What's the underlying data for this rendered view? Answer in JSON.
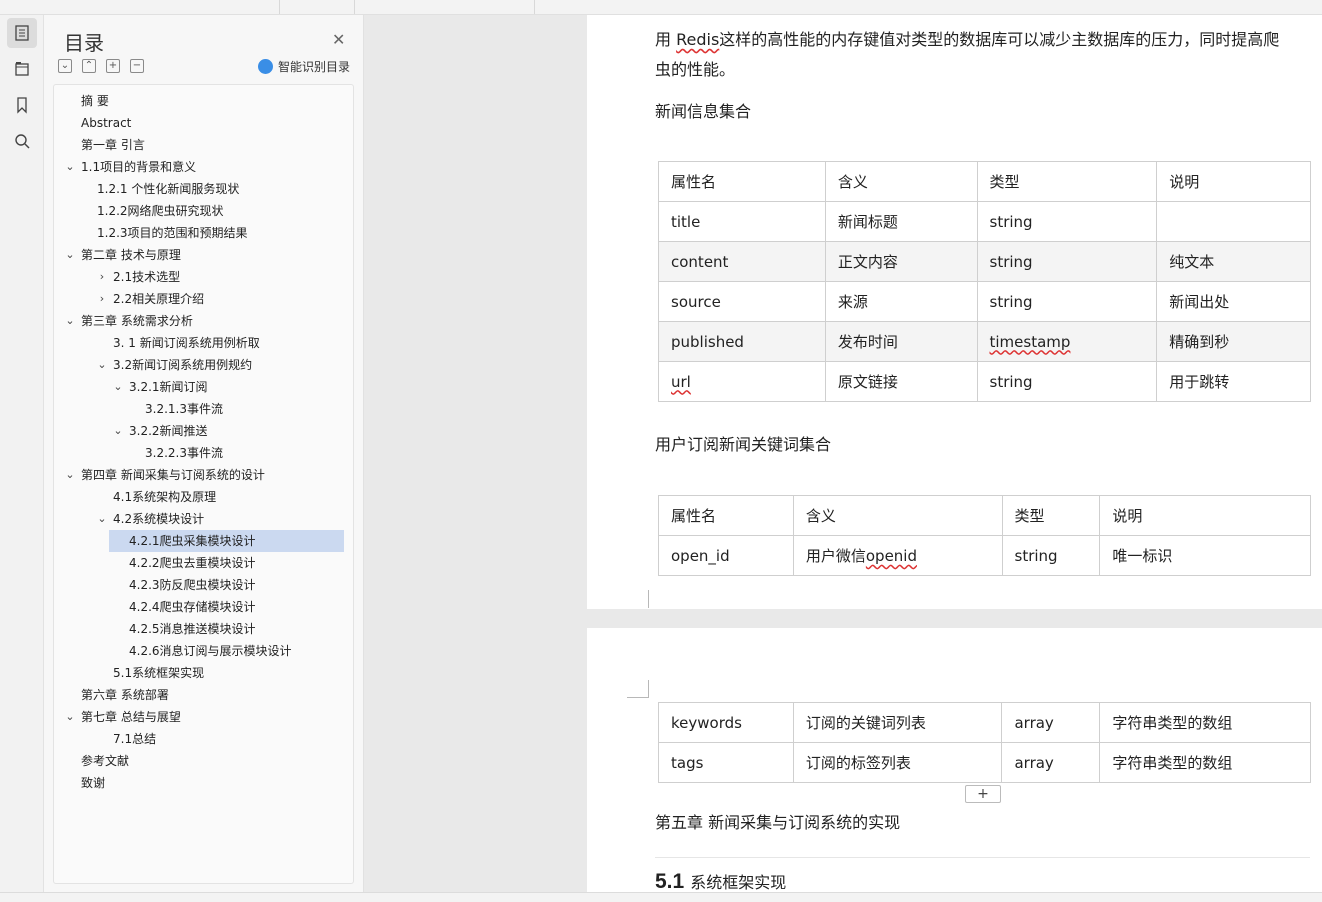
{
  "toc": {
    "title": "目录",
    "ai_label": "智能识别目录",
    "items": [
      {
        "label": "摘  要",
        "level": 0,
        "caret": ""
      },
      {
        "label": "Abstract",
        "level": 0,
        "caret": ""
      },
      {
        "label": "第一章 引言",
        "level": 0,
        "caret": ""
      },
      {
        "label": "1.1项目的背景和意义",
        "level": 0,
        "caret": "down"
      },
      {
        "label": "1.2.1 个性化新闻服务现状",
        "level": 1,
        "caret": ""
      },
      {
        "label": "1.2.2网络爬虫研究现状",
        "level": 1,
        "caret": ""
      },
      {
        "label": "1.2.3项目的范围和预期结果",
        "level": 1,
        "caret": ""
      },
      {
        "label": "第二章 技术与原理",
        "level": 0,
        "caret": "down"
      },
      {
        "label": "2.1技术选型",
        "level": 2,
        "caret": "right"
      },
      {
        "label": "2.2相关原理介绍",
        "level": 2,
        "caret": "right"
      },
      {
        "label": "第三章 系统需求分析",
        "level": 0,
        "caret": "down"
      },
      {
        "label": "3. 1 新闻订阅系统用例析取",
        "level": 2,
        "caret": ""
      },
      {
        "label": "3.2新闻订阅系统用例规约",
        "level": 2,
        "caret": "down"
      },
      {
        "label": "3.2.1新闻订阅",
        "level": 3,
        "caret": "down"
      },
      {
        "label": "3.2.1.3事件流",
        "level": 4,
        "caret": ""
      },
      {
        "label": "3.2.2新闻推送",
        "level": 3,
        "caret": "down"
      },
      {
        "label": "3.2.2.3事件流",
        "level": 4,
        "caret": ""
      },
      {
        "label": "第四章 新闻采集与订阅系统的设计",
        "level": 0,
        "caret": "down"
      },
      {
        "label": "4.1系统架构及原理",
        "level": 2,
        "caret": ""
      },
      {
        "label": "4.2系统模块设计",
        "level": 2,
        "caret": "down"
      },
      {
        "label": "4.2.1爬虫采集模块设计",
        "level": 3,
        "caret": "",
        "selected": true
      },
      {
        "label": "4.2.2爬虫去重模块设计",
        "level": 3,
        "caret": ""
      },
      {
        "label": "4.2.3防反爬虫模块设计",
        "level": 3,
        "caret": ""
      },
      {
        "label": "4.2.4爬虫存储模块设计",
        "level": 3,
        "caret": ""
      },
      {
        "label": "4.2.5消息推送模块设计",
        "level": 3,
        "caret": ""
      },
      {
        "label": "4.2.6消息订阅与展示模块设计",
        "level": 3,
        "caret": ""
      },
      {
        "label": "5.1系统框架实现",
        "level": 2,
        "caret": ""
      },
      {
        "label": "第六章 系统部署",
        "level": 0,
        "caret": ""
      },
      {
        "label": "第七章 总结与展望",
        "level": 0,
        "caret": "down"
      },
      {
        "label": "7.1总结",
        "level": 2,
        "caret": ""
      },
      {
        "label": "参考文献",
        "level": 0,
        "caret": ""
      },
      {
        "label": "致谢",
        "level": 0,
        "caret": ""
      }
    ]
  },
  "doc": {
    "line1_pre": "用 ",
    "line1_redis": "Redis",
    "line1_post": "这样的高性能的内存键值对类型的数据库可以减少主数据库的压力，同时提高爬",
    "line2": "虫的性能。",
    "news_set_title": "新闻信息集合",
    "table1": {
      "headers": [
        "属性名",
        "含义",
        "类型",
        "说明"
      ],
      "rows": [
        [
          "title",
          "新闻标题",
          "string",
          ""
        ],
        [
          "content",
          "正文内容",
          "string",
          "纯文本"
        ],
        [
          "source",
          "来源",
          "string",
          "新闻出处"
        ],
        [
          "published",
          "发布时间",
          "timestamp",
          "精确到秒"
        ],
        [
          "url",
          "原文链接",
          "string",
          "用于跳转"
        ]
      ]
    },
    "user_set_title": "用户订阅新闻关键词集合",
    "table2": {
      "headers": [
        "属性名",
        "含义",
        "类型",
        "说明"
      ],
      "rows": [
        [
          "open_id",
          "用户微信openid",
          "string",
          "唯一标识"
        ]
      ]
    },
    "table3": {
      "rows": [
        [
          "keywords",
          "订阅的关键词列表",
          "array",
          "字符串类型的数组"
        ],
        [
          "tags",
          "订阅的标签列表",
          "array",
          "字符串类型的数组"
        ]
      ]
    },
    "chapter5": "第五章 新闻采集与订阅系统的实现",
    "heading_num": "5.1",
    "heading_text": "系统框架实现",
    "add_row": "+"
  }
}
